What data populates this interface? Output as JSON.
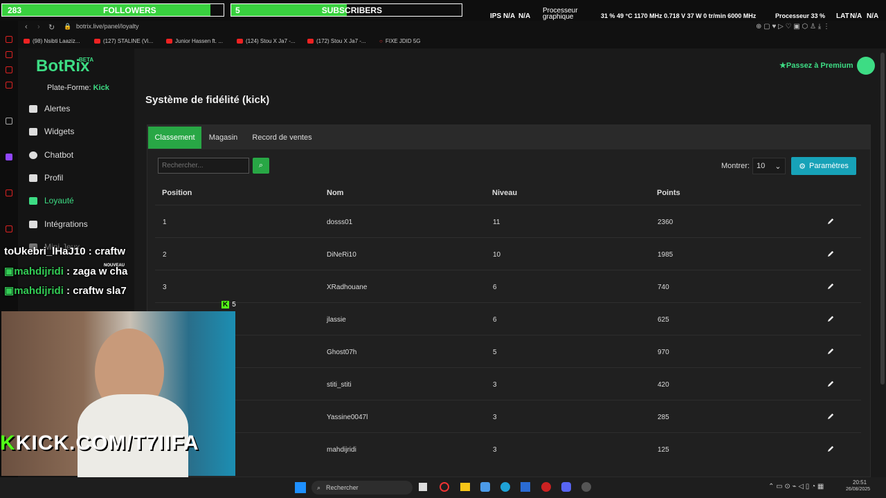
{
  "overlay": {
    "followers_goal": {
      "current": "283",
      "label": "FOLLOWERS",
      "target": "300",
      "progress": 0.94
    },
    "subscribers_goal": {
      "current": "5",
      "label": "SUBSCRIBERS",
      "target": "10",
      "progress": 0.5
    },
    "stats": {
      "ips": "IPS",
      "na1": "N/A",
      "na2": "N/A",
      "gpu_label1": "Processeur",
      "gpu_label2": "graphique",
      "gpu_values": "31 % 49 °C 1170 MHz 0.718 V 37 W 0 tr/min 6000 MHz",
      "cpu_label": "Processeur 33 %",
      "lat": "LAT",
      "lat_na1": "N/A",
      "lat_na2": "N/A"
    }
  },
  "browser": {
    "url": "botrix.live/panel/loyalty",
    "bookmarks": [
      "(98) Nsibti Laaziz...",
      "(127) STALINE (Vi...",
      "Junior Hassen ft. ...",
      "(124) Stou X Ja7 -...",
      "(172) Stou X Ja7 -...",
      "FIXE JDID 5G"
    ]
  },
  "app": {
    "logo": "BotRix",
    "beta": "BETA",
    "premium": "Passez à Premium",
    "platform_label": "Plate-Forme:",
    "platform_value": "Kick",
    "nav": [
      "Alertes",
      "Widgets",
      "Chatbot",
      "Profil",
      "Loyauté",
      "Intégrations",
      "Mini-Jeux"
    ],
    "page_title": "Système de fidélité (kick)",
    "tabs": [
      "Classement",
      "Magasin",
      "Record de ventes"
    ],
    "search_placeholder": "Rechercher...",
    "show_label": "Montrer:",
    "show_value": "10",
    "settings_button": "Paramètres",
    "columns": [
      "Position",
      "Nom",
      "Niveau",
      "Points"
    ],
    "rows": [
      {
        "pos": "1",
        "name": "dosss01",
        "level": "11",
        "points": "2360"
      },
      {
        "pos": "2",
        "name": "DiNeRi10",
        "level": "10",
        "points": "1985"
      },
      {
        "pos": "3",
        "name": "XRadhouane",
        "level": "6",
        "points": "740"
      },
      {
        "pos": "",
        "name": "jlassie",
        "level": "6",
        "points": "625"
      },
      {
        "pos": "",
        "name": "Ghost07h",
        "level": "5",
        "points": "970"
      },
      {
        "pos": "",
        "name": "stiti_stiti",
        "level": "3",
        "points": "420"
      },
      {
        "pos": "",
        "name": "Yassine0047l",
        "level": "3",
        "points": "285"
      },
      {
        "pos": "",
        "name": "mahdijridi",
        "level": "3",
        "points": "125"
      }
    ]
  },
  "stream": {
    "chat": [
      {
        "user": "toUkebri_lHaJ10",
        "msg": " : craftw"
      },
      {
        "user": "mahdijridi",
        "msg": " : zaga w cha"
      },
      {
        "user": "mahdijridi",
        "msg": " : craftw sla7"
      }
    ],
    "nouveau": "NOUVEAU",
    "kick_count": "5",
    "kick_url": "KICK.COM/T7IIFA"
  },
  "taskbar": {
    "search": "Rechercher",
    "time": "20:51",
    "date": "26/08/2025"
  }
}
